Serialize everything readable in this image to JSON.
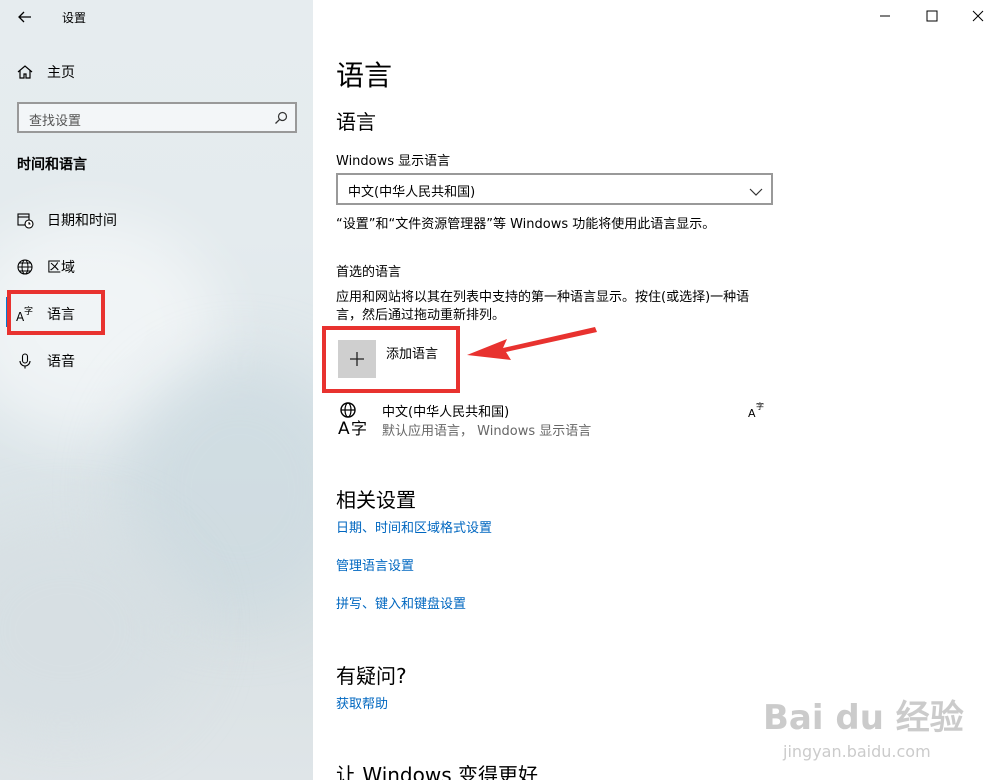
{
  "window": {
    "title": "设置",
    "controls": {
      "minimize": "—",
      "maximize": "☐",
      "close": "✕"
    }
  },
  "sidebar": {
    "home_label": "主页",
    "search_placeholder": "查找设置",
    "section_title": "时间和语言",
    "items": [
      {
        "label": "日期和时间",
        "icon": "calendar-clock-icon"
      },
      {
        "label": "区域",
        "icon": "globe-icon"
      },
      {
        "label": "语言",
        "icon": "language-icon",
        "selected": true
      },
      {
        "label": "语音",
        "icon": "microphone-icon"
      }
    ]
  },
  "main": {
    "page_title": "语言",
    "section_language": "语言",
    "display_language_label": "Windows 显示语言",
    "display_language_value": "中文(中华人民共和国)",
    "display_language_desc": "“设置”和“文件资源管理器”等 Windows 功能将使用此语言显示。",
    "preferred_label": "首选的语言",
    "preferred_desc_line1": "应用和网站将以其在列表中支持的第一种语言显示。按住(或选择)一种语",
    "preferred_desc_line2": "言，然后通过拖动重新排列。",
    "add_language_label": "添加语言",
    "language_item": {
      "name": "中文(中华人民共和国)",
      "detail": "默认应用语言， Windows 显示语言"
    },
    "related_title": "相关设置",
    "related_links": [
      "日期、时间和区域格式设置",
      "管理语言设置",
      "拼写、键入和键盘设置"
    ],
    "question_title": "有疑问?",
    "help_link": "获取帮助",
    "improve_title": "让 Windows 变得更好"
  },
  "watermark": {
    "brand": "Bai du 经验",
    "url": "jingyan.baidu.com"
  },
  "colors": {
    "accent": "#0078d4",
    "link": "#0067c0",
    "annotation": "#e8322f"
  }
}
